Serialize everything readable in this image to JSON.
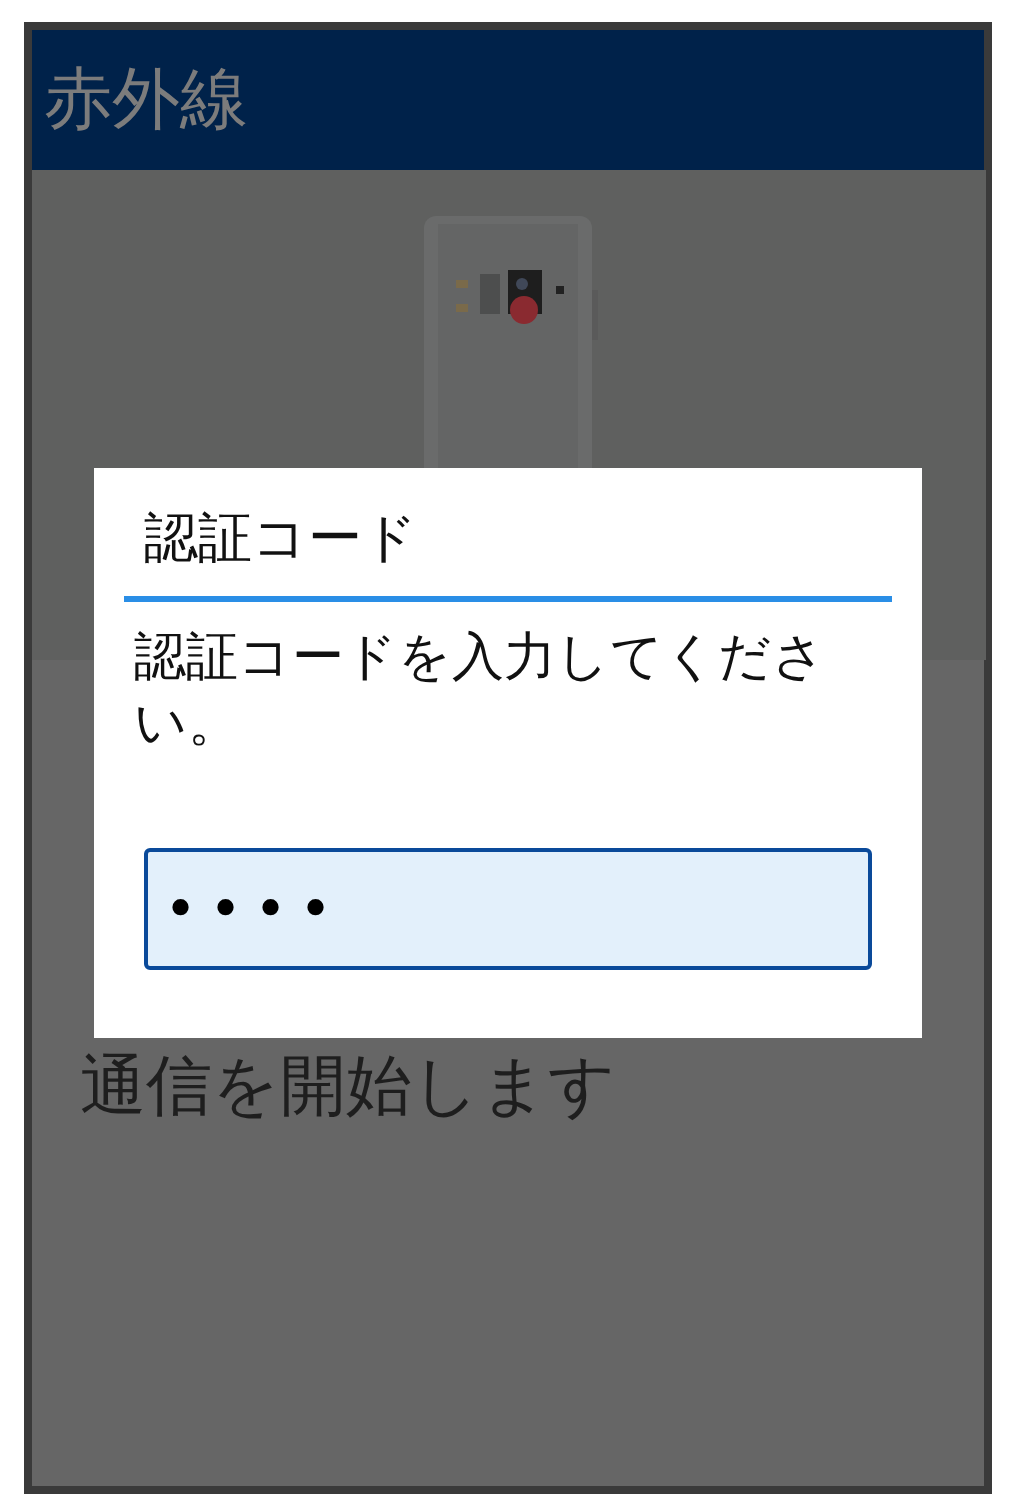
{
  "header": {
    "title": "赤外線"
  },
  "body": {
    "text": "通信を開始します"
  },
  "dialog": {
    "title": "認証コード",
    "message": "認証コードを入力してください。",
    "field": {
      "value": "••••",
      "focused": true
    }
  }
}
